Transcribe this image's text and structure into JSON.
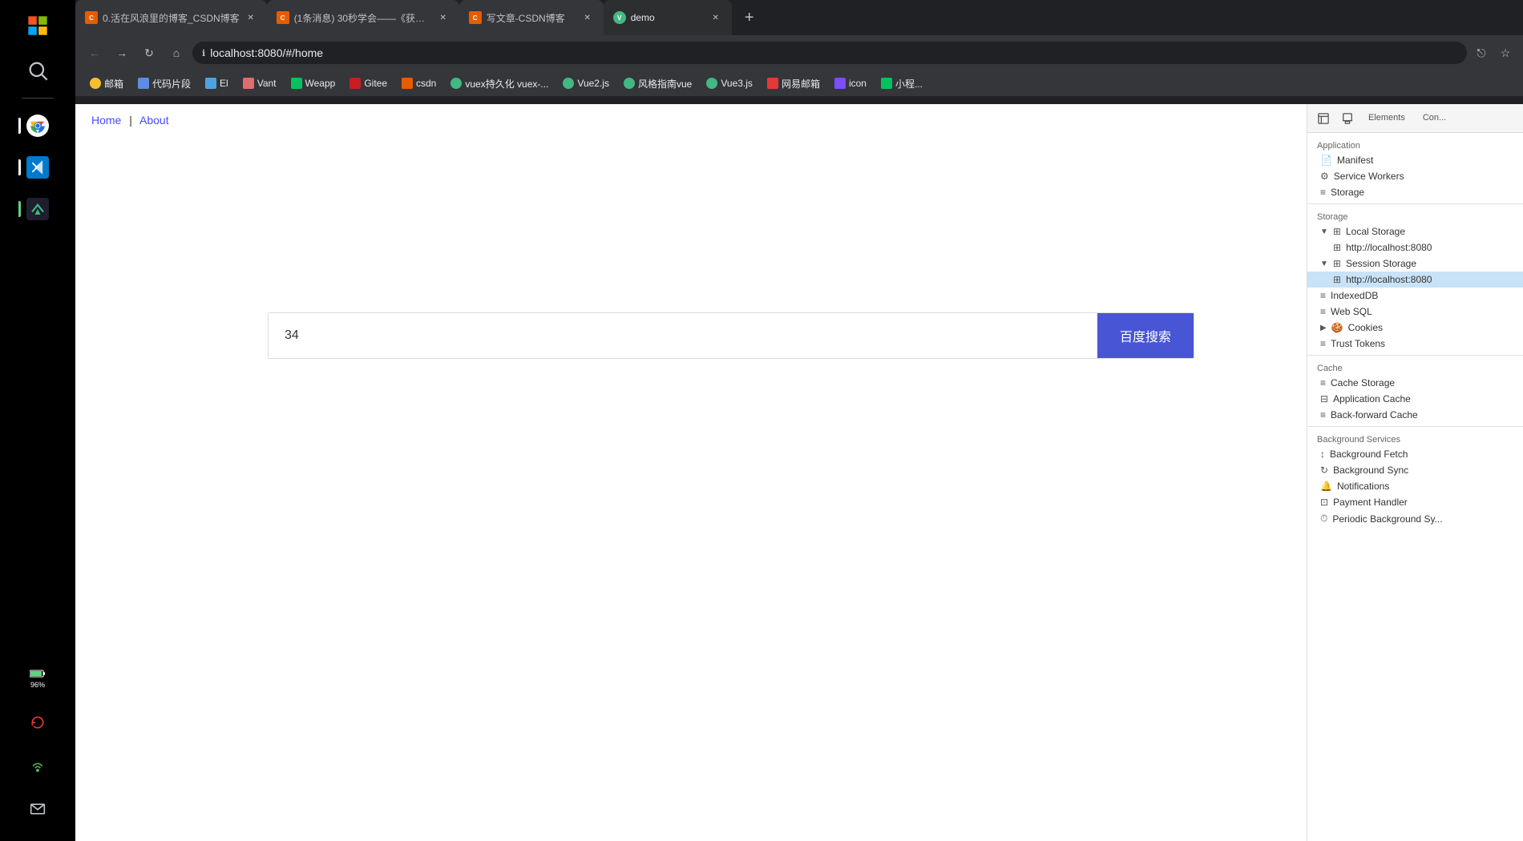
{
  "taskbar": {
    "icons": [
      {
        "name": "windows-icon",
        "label": "Start"
      },
      {
        "name": "search-icon",
        "label": "Search"
      },
      {
        "name": "separator",
        "label": ""
      },
      {
        "name": "chrome-icon",
        "label": "Google Chrome"
      },
      {
        "name": "vscode-icon",
        "label": "Visual Studio Code"
      },
      {
        "name": "unknown-icon",
        "label": "App"
      }
    ],
    "bottom_icons": [
      {
        "name": "battery-icon",
        "label": "96%"
      },
      {
        "name": "refresh-icon",
        "label": ""
      },
      {
        "name": "network-icon",
        "label": ""
      },
      {
        "name": "mail-icon",
        "label": ""
      }
    ]
  },
  "browser": {
    "tabs": [
      {
        "id": "tab1",
        "title": "0.活在风浪里的博客_CSDN博客",
        "active": false,
        "favicon": "csdn"
      },
      {
        "id": "tab2",
        "title": "(1条消息) 30秒学会——《获取...",
        "active": false,
        "favicon": "csdn"
      },
      {
        "id": "tab3",
        "title": "写文章-CSDN博客",
        "active": false,
        "favicon": "csdn"
      },
      {
        "id": "tab4",
        "title": "demo",
        "active": true,
        "favicon": "vue"
      }
    ],
    "address": "localhost:8080/#/home",
    "bookmarks": [
      {
        "label": "邮箱",
        "icon": "mail"
      },
      {
        "label": "代码片段",
        "icon": "code"
      },
      {
        "label": "El",
        "icon": "el"
      },
      {
        "label": "Vant",
        "icon": "vant"
      },
      {
        "label": "Weapp",
        "icon": "weapp"
      },
      {
        "label": "Gitee",
        "icon": "gitee"
      },
      {
        "label": "csdn",
        "icon": "csdn"
      },
      {
        "label": "vuex持久化 vuex-...",
        "icon": "vuex"
      },
      {
        "label": "Vue2.js",
        "icon": "vue2"
      },
      {
        "label": "风格指南vue",
        "icon": "vue"
      },
      {
        "label": "Vue3.js",
        "icon": "vue3"
      },
      {
        "label": "网易邮箱",
        "icon": "mail2"
      },
      {
        "label": "icon",
        "icon": "icon"
      },
      {
        "label": "小程...",
        "icon": "mini"
      }
    ]
  },
  "page": {
    "nav_home": "Home",
    "nav_separator": "|",
    "nav_about": "About",
    "search_value": "34",
    "search_btn": "百度搜索"
  },
  "devtools": {
    "toolbar_tabs": [
      "Elements",
      "Con..."
    ],
    "sections": {
      "application": {
        "label": "Application",
        "items": [
          {
            "id": "manifest",
            "label": "Manifest",
            "icon": "doc"
          },
          {
            "id": "service-workers",
            "label": "Service Workers",
            "icon": "gear"
          },
          {
            "id": "storage",
            "label": "Storage",
            "icon": "db"
          }
        ]
      },
      "storage": {
        "label": "Storage",
        "items": [
          {
            "id": "local-storage",
            "label": "Local Storage",
            "icon": "db",
            "expandable": true,
            "expanded": true
          },
          {
            "id": "local-storage-url",
            "label": "http://localhost:8080",
            "icon": "db",
            "sub": true
          },
          {
            "id": "session-storage",
            "label": "Session Storage",
            "icon": "db",
            "expandable": true,
            "expanded": true
          },
          {
            "id": "session-storage-url",
            "label": "http://localhost:8080",
            "icon": "db",
            "sub": true,
            "selected": true
          },
          {
            "id": "indexeddb",
            "label": "IndexedDB",
            "icon": "db"
          },
          {
            "id": "web-sql",
            "label": "Web SQL",
            "icon": "db"
          },
          {
            "id": "cookies",
            "label": "Cookies",
            "icon": "cookie",
            "expandable": true,
            "expanded": false
          },
          {
            "id": "trust-tokens",
            "label": "Trust Tokens",
            "icon": "db"
          }
        ]
      },
      "cache": {
        "label": "Cache",
        "items": [
          {
            "id": "cache-storage",
            "label": "Cache Storage",
            "icon": "db"
          },
          {
            "id": "application-cache",
            "label": "Application Cache",
            "icon": "db2"
          },
          {
            "id": "back-forward-cache",
            "label": "Back-forward Cache",
            "icon": "db"
          }
        ]
      },
      "background-services": {
        "label": "Background Services",
        "items": [
          {
            "id": "background-fetch",
            "label": "Background Fetch",
            "icon": "arrow-up-down"
          },
          {
            "id": "background-sync",
            "label": "Background Sync",
            "icon": "sync"
          },
          {
            "id": "notifications",
            "label": "Notifications",
            "icon": "bell"
          },
          {
            "id": "payment-handler",
            "label": "Payment Handler",
            "icon": "payment"
          },
          {
            "id": "periodic-background-sync",
            "label": "Periodic Background Sy...",
            "icon": "clock"
          }
        ]
      }
    }
  }
}
